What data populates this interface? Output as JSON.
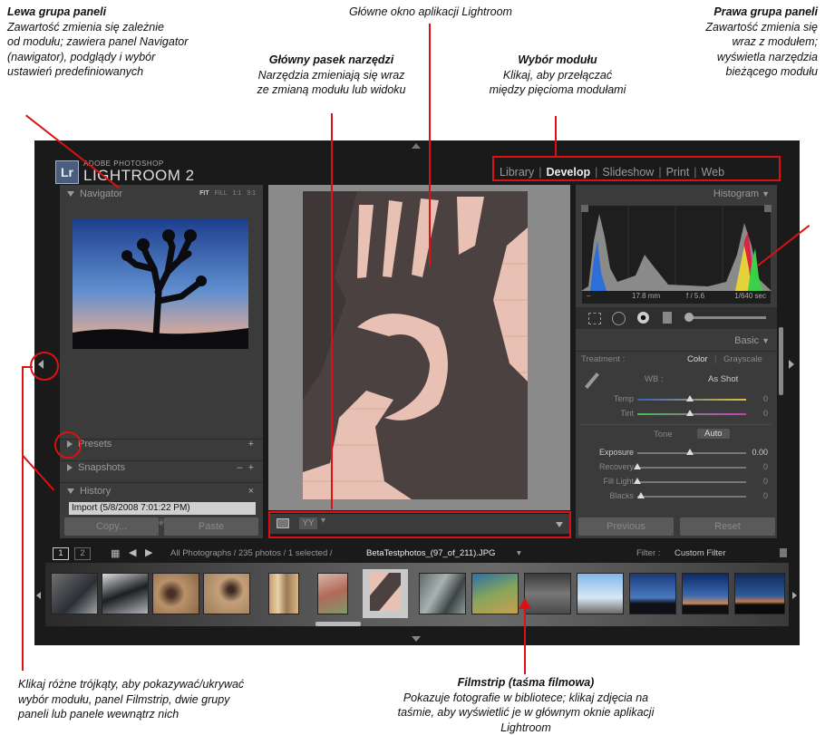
{
  "annotations": {
    "left_panels": {
      "title": "Lewa grupa paneli",
      "lines": [
        "Zawartość zmienia się zależnie",
        "od modułu; zawiera panel Navigator",
        "(nawigator), podglądy i wybór",
        "ustawień predefiniowanych"
      ]
    },
    "main_window": {
      "title": "Główne okno aplikacji Lightroom"
    },
    "toolbar": {
      "title": "Główny pasek narzędzi",
      "lines": [
        "Narzędzia zmieniają się wraz",
        "ze zmianą modułu lub widoku"
      ]
    },
    "module_picker": {
      "title": "Wybór modułu",
      "lines": [
        "Klikaj, aby przełączać",
        "między pięcioma modułami"
      ]
    },
    "right_panels": {
      "title": "Prawa grupa paneli",
      "lines": [
        "Zawartość zmienia się",
        "wraz z modułem;",
        "wyświetla narzędzia",
        "bieżącego modułu"
      ]
    },
    "triangles": {
      "lines": [
        "Klikaj różne trójkąty, aby pokazywać/ukrywać",
        "wybór modułu, panel Filmstrip, dwie grupy",
        "paneli lub panele wewnątrz nich"
      ]
    },
    "filmstrip": {
      "title": "Filmstrip (taśma filmowa)",
      "lines": [
        "Pokazuje fotografie w bibliotece; klikaj zdjęcia na",
        "taśmie, aby wyświetlić je w głównym oknie aplikacji Lightroom"
      ]
    }
  },
  "app": {
    "brand_small": "ADOBE PHOTOSHOP",
    "brand_big": "LIGHTROOM 2",
    "brand_logo": "Lr",
    "modules": [
      "Library",
      "Develop",
      "Slideshow",
      "Print",
      "Web"
    ],
    "active_module": "Develop",
    "left": {
      "navigator": "Navigator",
      "zoom_fit": "FIT",
      "zoom_fill": "FILL",
      "zoom_1": "1:1",
      "zoom_3": "3:1",
      "presets": "Presets",
      "snapshots": "Snapshots",
      "history": "History",
      "history_item": "Import (5/8/2008 7:01:22 PM)",
      "copy": "Copy...",
      "paste": "Paste"
    },
    "right": {
      "histogram": "Histogram",
      "hist_mm": "17.8 mm",
      "hist_f": "f / 5.6",
      "hist_sec": "1/640 sec",
      "basic": "Basic",
      "treatment": "Treatment :",
      "color": "Color",
      "grayscale": "Grayscale",
      "wb": "WB :",
      "as_shot": "As Shot",
      "temp": "Temp",
      "tint": "Tint",
      "tone": "Tone",
      "auto": "Auto",
      "exposure": "Exposure",
      "exposure_val": "0.00",
      "recovery": "Recovery",
      "fill_light": "Fill Light",
      "blacks": "Blacks",
      "zero": "0",
      "previous": "Previous",
      "reset": "Reset"
    },
    "filmbar": {
      "screen1": "1",
      "screen2": "2",
      "path": "All Photographs / 235 photos / 1 selected /",
      "filename": "BetaTestphotos_(97_of_211).JPG",
      "filter_label": "Filter :",
      "filter_value": "Custom Filter"
    }
  },
  "colors": {
    "annotation_red": "#dd1111",
    "app_bg": "#1a1a1a",
    "panel_bg": "#3b3b3b"
  }
}
